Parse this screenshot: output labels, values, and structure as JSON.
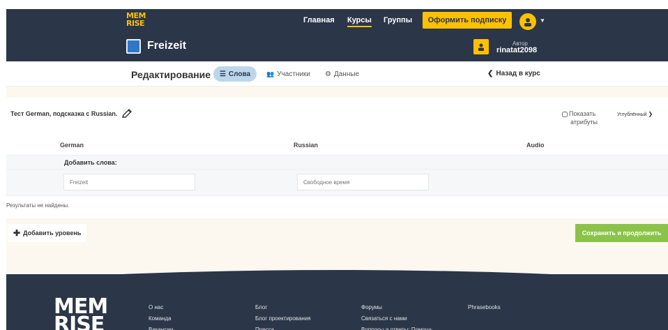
{
  "header": {
    "logo_line1": "MEM",
    "logo_line2": "RISE",
    "nav": [
      "Главная",
      "Курсы",
      "Группы"
    ],
    "subscribe": "Оформить подписку",
    "course_title": "Freizeit",
    "author_label": "Автор",
    "author_name": "rinatat2098"
  },
  "tabs": {
    "title": "Редактирование",
    "words": "Слова",
    "participants": "Участники",
    "data": "Данные",
    "back": "Назад в курс"
  },
  "content": {
    "test_label": "Тест German, подсказка с Russian.",
    "show_attr_1": "Показать",
    "show_attr_2": "атрибуты",
    "advanced": "Углублённый",
    "columns": [
      "German",
      "Russian",
      "Audio"
    ],
    "add_words": "Добавить слова:",
    "input_german_placeholder": "Freizeit",
    "input_russian_placeholder": "Свободное время",
    "no_results": "Результаты не найдены.",
    "add_level": "Добавить уровень",
    "save": "Сохранить и продолжить"
  },
  "footer": {
    "logo_line1": "MEM",
    "logo_line2": "RISE",
    "col1": [
      "О нас",
      "Команда",
      "Вакансии"
    ],
    "col2": [
      "Блог",
      "Блог проектирования",
      "Пресса"
    ],
    "col3": [
      "Форумы",
      "Связаться с нами",
      "Вопросы и ответы: Помощь"
    ],
    "col4": [
      "Phrasebooks"
    ]
  },
  "colors": {
    "header_bg": "#2b3648",
    "accent_yellow": "#ffc000",
    "save_green": "#8bc34a",
    "pill_blue": "#bcd7ea"
  }
}
